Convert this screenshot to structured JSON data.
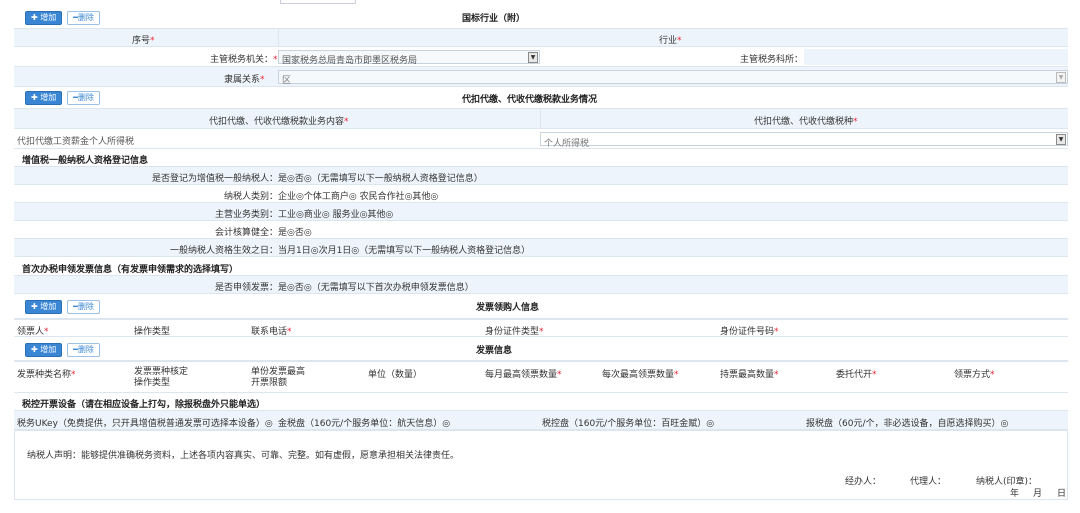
{
  "buttons": {
    "add": "增加",
    "delete": "删除"
  },
  "icons": {
    "add": "plus-icon",
    "delete": "minus-icon",
    "dropdown": "dropdown-arrow-icon"
  },
  "intl_industry": {
    "title": "国标行业（附）",
    "col_seq": "序号",
    "col_industry": "行业"
  },
  "tax_authority": {
    "label": "主管税务机关：",
    "value": "国家税务总局青岛市即墨区税务局",
    "section_label": "主管税务科所："
  },
  "affiliation": {
    "label": "隶属关系",
    "value": "区"
  },
  "withholding": {
    "title": "代扣代缴、代收代缴税款业务情况",
    "col_content": "代扣代缴、代收代缴税款业务内容",
    "col_tax": "代扣代缴、代收代缴税种",
    "content_value": "代扣代缴工资薪金个人所得税",
    "tax_value": "个人所得税"
  },
  "vat": {
    "title": "增值税一般纳税人资格登记信息",
    "q1_label": "是否登记为增值税一般纳税人：",
    "q1_opts": "是◎否◎（无需填写以下一般纳税人资格登记信息）",
    "q2_label": "纳税人类别：",
    "q2_opts": "企业◎个体工商户◎ 农民合作社◎其他◎",
    "q3_label": "主营业务类别：",
    "q3_opts": "工业◎商业◎ 服务业◎其他◎",
    "q4_label": "会计核算健全：",
    "q4_opts": "是◎否◎",
    "q5_label": "一般纳税人资格生效之日：",
    "q5_opts": "当月1日◎次月1日◎（无需填写以下一般纳税人资格登记信息）"
  },
  "first_invoice": {
    "title": "首次办税申领发票信息（有发票申领需求的选择填写）",
    "q_label": "是否申领发票：",
    "q_opts": "是◎否◎（无需填写以下首次办税申领发票信息）"
  },
  "recipient": {
    "title": "发票领购人信息",
    "cols": [
      "领票人",
      "操作类型",
      "联系电话",
      "身份证件类型",
      "身份证件号码"
    ]
  },
  "invoice": {
    "title": "发票信息",
    "cols": [
      "发票种类名称",
      "发票票种核定\n操作类型",
      "单份发票最高\n开票限额",
      "单位（数量）",
      "每月最高领票数量",
      "每次最高领票数量",
      "持票最高数量",
      "委托代开",
      "领票方式"
    ]
  },
  "tax_control": {
    "title": "税控开票设备（请在相应设备上打勾，除报税盘外只能单选）",
    "opt1": "税务UKey（免费提供，只开具增值税普通发票可选择本设备）◎",
    "opt2": "金税盘（160元/个服务单位：航天信息）◎",
    "opt3": "税控盘（160元/个服务单位：百旺金赋）◎",
    "opt4": "报税盘（60元/个，非必选设备，自愿选择购买）◎"
  },
  "declaration": {
    "text": "纳税人声明：能够提供准确税务资料，上述各项内容真实、可靠、完整。如有虚假，愿意承担相关法律责任。",
    "handler": "经办人：",
    "agent": "代理人：",
    "taxpayer_seal": "纳税人(印章)：",
    "year": "年",
    "month": "月",
    "day": "日"
  }
}
